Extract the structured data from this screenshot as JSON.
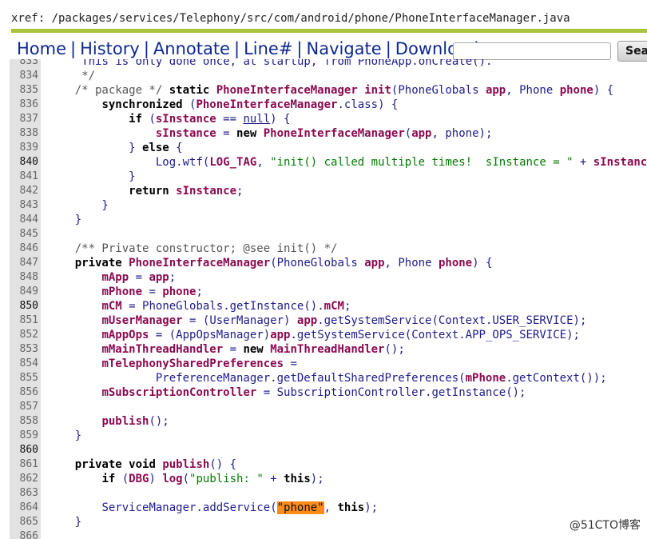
{
  "xref": "xref: /packages/services/Telephony/src/com/android/phone/PhoneInterfaceManager.java",
  "nav": {
    "home": "Home",
    "history": "History",
    "annotate": "Annotate",
    "line": "Line#",
    "navigate": "Navigate",
    "download": "Download",
    "separator": "|",
    "search_button": "Sea"
  },
  "colors": {
    "nav_link": "#0c2891",
    "rule": "#a9c33c",
    "highlight": "#ff8c1a",
    "field": "#8b0a50",
    "string": "#007c00"
  },
  "lines": [
    {
      "n": "833",
      "t": "     This is only done once, at startup, from PhoneApp.onCreate()."
    },
    {
      "n": "834",
      "t": "     */"
    },
    {
      "n": "835",
      "t": "    /* package */ static PhoneInterfaceManager init(PhoneGlobals app, Phone phone) {"
    },
    {
      "n": "836",
      "t": "        synchronized (PhoneInterfaceManager.class) {"
    },
    {
      "n": "837",
      "t": "            if (sInstance == null) {"
    },
    {
      "n": "838",
      "t": "                sInstance = new PhoneInterfaceManager(app, phone);"
    },
    {
      "n": "839",
      "t": "            } else {"
    },
    {
      "n": "840",
      "t": "                Log.wtf(LOG_TAG, \"init() called multiple times!  sInstance = \" + sInstance);"
    },
    {
      "n": "841",
      "t": "            }"
    },
    {
      "n": "842",
      "t": "            return sInstance;"
    },
    {
      "n": "843",
      "t": "        }"
    },
    {
      "n": "844",
      "t": "    }"
    },
    {
      "n": "845",
      "t": ""
    },
    {
      "n": "846",
      "t": "    /** Private constructor; @see init() */"
    },
    {
      "n": "847",
      "t": "    private PhoneInterfaceManager(PhoneGlobals app, Phone phone) {"
    },
    {
      "n": "848",
      "t": "        mApp = app;"
    },
    {
      "n": "849",
      "t": "        mPhone = phone;"
    },
    {
      "n": "850",
      "t": "        mCM = PhoneGlobals.getInstance().mCM;"
    },
    {
      "n": "851",
      "t": "        mUserManager = (UserManager) app.getSystemService(Context.USER_SERVICE);"
    },
    {
      "n": "852",
      "t": "        mAppOps = (AppOpsManager)app.getSystemService(Context.APP_OPS_SERVICE);"
    },
    {
      "n": "853",
      "t": "        mMainThreadHandler = new MainThreadHandler();"
    },
    {
      "n": "854",
      "t": "        mTelephonySharedPreferences ="
    },
    {
      "n": "855",
      "t": "                PreferenceManager.getDefaultSharedPreferences(mPhone.getContext());"
    },
    {
      "n": "856",
      "t": "        mSubscriptionController = SubscriptionController.getInstance();"
    },
    {
      "n": "857",
      "t": ""
    },
    {
      "n": "858",
      "t": "        publish();"
    },
    {
      "n": "859",
      "t": "    }"
    },
    {
      "n": "860",
      "t": ""
    },
    {
      "n": "861",
      "t": "    private void publish() {"
    },
    {
      "n": "862",
      "t": "        if (DBG) log(\"publish: \" + this);"
    },
    {
      "n": "863",
      "t": ""
    },
    {
      "n": "864",
      "t": "        ServiceManager.addService(\"phone\", this);"
    },
    {
      "n": "865",
      "t": "    }"
    },
    {
      "n": "866",
      "t": ""
    }
  ],
  "highlight_token": "\"phone\"",
  "watermark": "@51CTO博客"
}
